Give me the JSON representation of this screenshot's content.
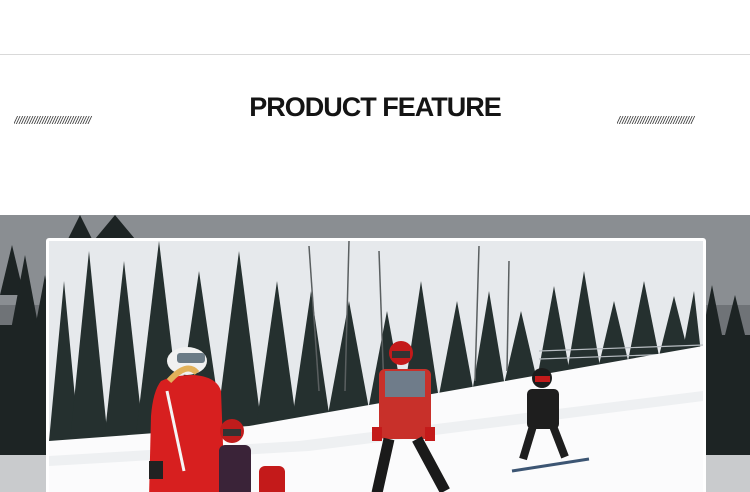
{
  "header": {
    "title": "PRODUCT FEATURE",
    "left_decoration": "//////////////////////////////",
    "right_decoration": "//////////////////////////////"
  },
  "photo": {
    "subject": "family-skiing-photo",
    "colors": {
      "sky": "#e9ecef",
      "snow": "#fbfbfc",
      "forest": "#1f2a2a",
      "jacket_red": "#d71f1f",
      "helmet_white": "#f2f2f2"
    }
  }
}
